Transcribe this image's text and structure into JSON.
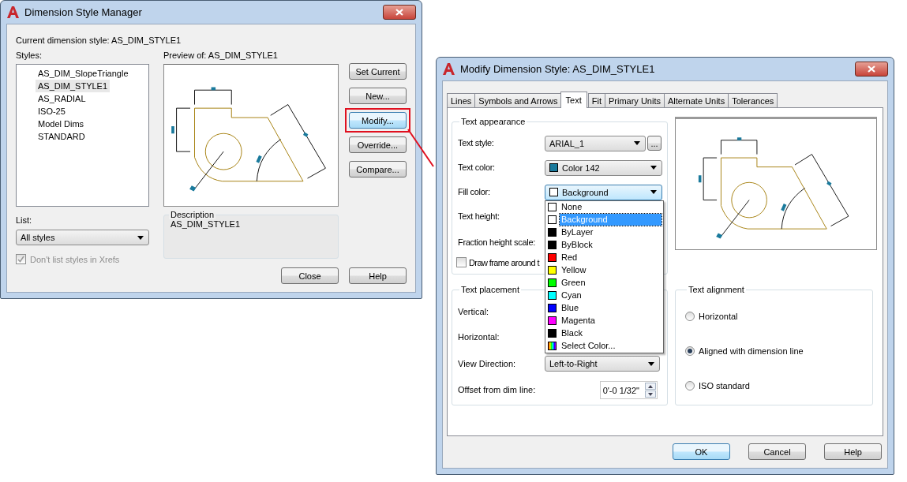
{
  "manager": {
    "title": "Dimension Style Manager",
    "current": "Current dimension style: AS_DIM_STYLE1",
    "styles_label": "Styles:",
    "styles": [
      {
        "label": "AS_DIM_SlopeTriangle",
        "selected": false
      },
      {
        "label": "AS_DIM_STYLE1",
        "selected": true
      },
      {
        "label": "AS_RADIAL",
        "selected": false
      },
      {
        "label": "ISO-25",
        "selected": false
      },
      {
        "label": "Model Dims",
        "selected": false
      },
      {
        "label": "STANDARD",
        "selected": false
      }
    ],
    "preview_label": "Preview of: AS_DIM_STYLE1",
    "list_label": "List:",
    "list_value": "All styles",
    "xrefs": {
      "label": "Don't list styles in Xrefs",
      "checked": true,
      "disabled": true
    },
    "description_label": "Description",
    "description": "AS_DIM_STYLE1",
    "side_buttons": [
      {
        "label": "Set Current",
        "highlighted": false
      },
      {
        "label": "New...",
        "highlighted": false
      },
      {
        "label": "Modify...",
        "highlighted": true
      },
      {
        "label": "Override...",
        "highlighted": false
      },
      {
        "label": "Compare...",
        "highlighted": false
      }
    ],
    "buttons": [
      "Close",
      "Help"
    ]
  },
  "modify": {
    "title": "Modify Dimension Style: AS_DIM_STYLE1",
    "tabs": [
      {
        "label": "Lines",
        "selected": false
      },
      {
        "label": "Symbols and Arrows",
        "selected": false
      },
      {
        "label": "Text",
        "selected": true
      },
      {
        "label": "Fit",
        "selected": false
      },
      {
        "label": "Primary Units",
        "selected": false
      },
      {
        "label": "Alternate Units",
        "selected": false
      },
      {
        "label": "Tolerances",
        "selected": false
      }
    ],
    "appearance": {
      "title": "Text appearance",
      "text_style": {
        "label": "Text style:",
        "value": "ARIAL_1",
        "button": "..."
      },
      "text_color": {
        "label": "Text color:",
        "value": "Color 142",
        "color": "#1a7a9c"
      },
      "fill_color": {
        "label": "Fill color:",
        "value": "Background",
        "color": "#ffffff",
        "expanded": true,
        "options": [
          {
            "label": "None",
            "color": "#ffffff",
            "kind": "swatch",
            "selected": false
          },
          {
            "label": "Background",
            "color": "#ffffff",
            "kind": "swatch",
            "selected": true
          },
          {
            "label": "ByLayer",
            "color": "#000000",
            "kind": "swatch",
            "selected": false
          },
          {
            "label": "ByBlock",
            "color": "#000000",
            "kind": "swatch",
            "selected": false
          },
          {
            "label": "Red",
            "color": "#ff0000",
            "kind": "swatch",
            "selected": false
          },
          {
            "label": "Yellow",
            "color": "#ffff00",
            "kind": "swatch",
            "selected": false
          },
          {
            "label": "Green",
            "color": "#00ff00",
            "kind": "swatch",
            "selected": false
          },
          {
            "label": "Cyan",
            "color": "#00ffff",
            "kind": "swatch",
            "selected": false
          },
          {
            "label": "Blue",
            "color": "#0000ff",
            "kind": "swatch",
            "selected": false
          },
          {
            "label": "Magenta",
            "color": "#ff00ff",
            "kind": "swatch",
            "selected": false
          },
          {
            "label": "Black",
            "color": "#000000",
            "kind": "swatch",
            "selected": false
          },
          {
            "label": "Select Color...",
            "kind": "picker",
            "selected": false
          }
        ]
      },
      "text_height": {
        "label": "Text height:"
      },
      "fraction_scale": {
        "label": "Fraction height scale:"
      },
      "frame": {
        "label": "Draw frame around t",
        "checked": false
      }
    },
    "placement": {
      "title": "Text placement",
      "vertical": {
        "label": "Vertical:"
      },
      "horizontal": {
        "label": "Horizontal:"
      },
      "view_direction": {
        "label": "View Direction:",
        "value": "Left-to-Right"
      },
      "offset": {
        "label": "Offset from dim line:",
        "value": "0'-0 1/32\""
      }
    },
    "alignment": {
      "title": "Text alignment",
      "options": [
        {
          "label": "Horizontal",
          "selected": false
        },
        {
          "label": "Aligned with dimension line",
          "selected": true
        },
        {
          "label": "ISO standard",
          "selected": false
        }
      ]
    },
    "buttons": [
      {
        "label": "OK",
        "default": true
      },
      {
        "label": "Cancel",
        "default": false
      },
      {
        "label": "Help",
        "default": false
      }
    ]
  }
}
